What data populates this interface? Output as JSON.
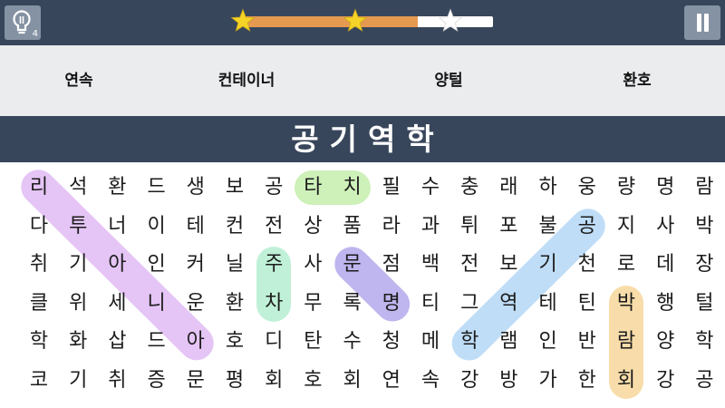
{
  "toolbar": {
    "hint_icon": "lightbulb-icon",
    "hint_count": "4",
    "pause_icon": "pause-icon",
    "progress": 0.7,
    "stars": [
      {
        "filled": true,
        "progress_at": 0.0
      },
      {
        "filled": true,
        "progress_at": 0.45
      },
      {
        "filled": false,
        "progress_at": 0.83
      }
    ],
    "star_icon": "star-icon",
    "colors": {
      "bar": "#38465b",
      "button": "#8592a3",
      "fill": "#e69a50",
      "star_filled": "#f5d327",
      "star_empty": "#ffffff"
    }
  },
  "target_words": [
    "연속",
    "컨테이너",
    "양털",
    "환호"
  ],
  "category": "공기역학",
  "grid": {
    "rows": [
      [
        "리",
        "석",
        "환",
        "드",
        "생",
        "보",
        "공",
        "타",
        "치",
        "필",
        "수",
        "충",
        "래",
        "하",
        "웅",
        "량",
        "명",
        "람"
      ],
      [
        "다",
        "투",
        "너",
        "이",
        "테",
        "컨",
        "전",
        "상",
        "품",
        "라",
        "과",
        "튀",
        "포",
        "불",
        "공",
        "지",
        "사",
        "박"
      ],
      [
        "취",
        "기",
        "아",
        "인",
        "커",
        "닐",
        "주",
        "사",
        "문",
        "점",
        "백",
        "전",
        "보",
        "기",
        "천",
        "로",
        "데",
        "장"
      ],
      [
        "클",
        "위",
        "세",
        "니",
        "운",
        "환",
        "차",
        "무",
        "록",
        "명",
        "티",
        "그",
        "역",
        "테",
        "틴",
        "박",
        "행",
        "털"
      ],
      [
        "학",
        "화",
        "삽",
        "드",
        "아",
        "호",
        "디",
        "탄",
        "수",
        "청",
        "메",
        "학",
        "램",
        "인",
        "반",
        "람",
        "양",
        "학"
      ],
      [
        "코",
        "기",
        "취",
        "증",
        "문",
        "평",
        "회",
        "호",
        "회",
        "연",
        "속",
        "강",
        "방",
        "가",
        "한",
        "회",
        "강",
        "공"
      ]
    ],
    "found": [
      {
        "word": "리투아니아",
        "from": [
          0,
          0
        ],
        "to": [
          4,
          4
        ],
        "color": "#e5c5f5"
      },
      {
        "word": "타치",
        "from": [
          0,
          7
        ],
        "to": [
          0,
          8
        ],
        "color": "#cdf1b9"
      },
      {
        "word": "주차",
        "from": [
          2,
          6
        ],
        "to": [
          3,
          6
        ],
        "color": "#c0f1d8"
      },
      {
        "word": "문명",
        "from": [
          2,
          8
        ],
        "to": [
          3,
          9
        ],
        "color": "#bfb6ef"
      },
      {
        "word": "공기역학",
        "from": [
          1,
          14
        ],
        "to": [
          4,
          11
        ],
        "color": "#bfddf7"
      },
      {
        "word": "박람회",
        "from": [
          3,
          15
        ],
        "to": [
          5,
          15
        ],
        "color": "#f8ddaa"
      }
    ]
  }
}
